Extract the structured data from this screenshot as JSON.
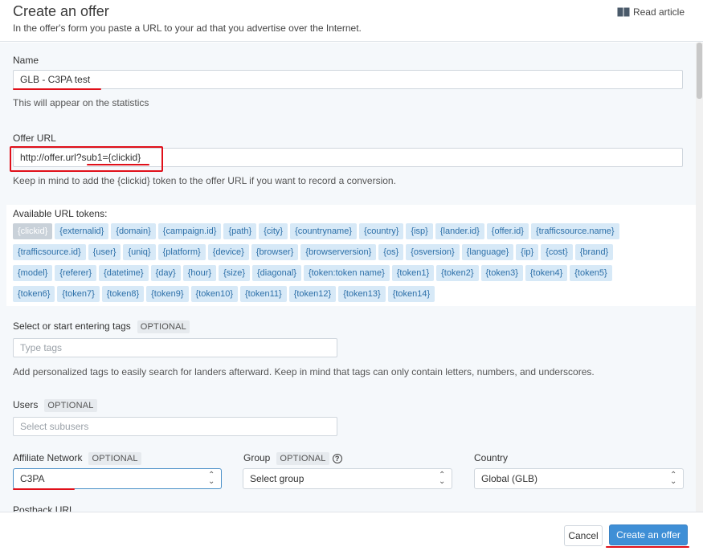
{
  "header": {
    "title": "Create an offer",
    "subtitle": "In the offer's form you paste a URL to your ad that you advertise over the Internet.",
    "read_article": "Read article"
  },
  "name_field": {
    "label": "Name",
    "value": "GLB - C3PA test",
    "help": "This will appear on the statistics"
  },
  "offer_url": {
    "label": "Offer URL",
    "value": "http://offer.url?sub1={clickid}",
    "help": "Keep in mind to add the {clickid} token to the offer URL if you want to record a conversion."
  },
  "tokens": {
    "label": "Available URL tokens:",
    "rows": [
      [
        "{clickid}",
        "{externalid}",
        "{domain}",
        "{campaign.id}",
        "{path}",
        "{city}",
        "{countryname}",
        "{country}",
        "{isp}",
        "{lander.id}",
        "{offer.id}",
        "{trafficsource.name}"
      ],
      [
        "{trafficsource.id}",
        "{user}",
        "{uniq}",
        "{platform}",
        "{device}",
        "{browser}",
        "{browserversion}",
        "{os}",
        "{osversion}",
        "{language}",
        "{ip}",
        "{cost}",
        "{brand}"
      ],
      [
        "{model}",
        "{referer}",
        "{datetime}",
        "{day}",
        "{hour}",
        "{size}",
        "{diagonal}",
        "{token:token name}",
        "{token1}",
        "{token2}",
        "{token3}",
        "{token4}",
        "{token5}"
      ],
      [
        "{token6}",
        "{token7}",
        "{token8}",
        "{token9}",
        "{token10}",
        "{token11}",
        "{token12}",
        "{token13}",
        "{token14}"
      ]
    ]
  },
  "tags": {
    "label": "Select or start entering tags",
    "optional": "OPTIONAL",
    "placeholder": "Type tags",
    "help": "Add personalized tags to easily search for landers afterward. Keep in mind that tags can only contain letters, numbers, and underscores."
  },
  "users": {
    "label": "Users",
    "optional": "OPTIONAL",
    "placeholder": "Select subusers"
  },
  "affiliate_network": {
    "label": "Affiliate Network",
    "optional": "OPTIONAL",
    "value": "C3PA"
  },
  "group": {
    "label": "Group",
    "optional": "OPTIONAL",
    "help_glyph": "?",
    "value": "Select group"
  },
  "country": {
    "label": "Country",
    "value": "Global (GLB)"
  },
  "postback": {
    "label": "Postback URL"
  },
  "footer": {
    "cancel_label": "Cancel",
    "create_label": "Create an offer"
  },
  "colors": {
    "primary_button": "#3f8fd6",
    "token_bg": "#d7e9f7",
    "token_text": "#2c6fa8",
    "annotation_red": "#e0101a"
  }
}
